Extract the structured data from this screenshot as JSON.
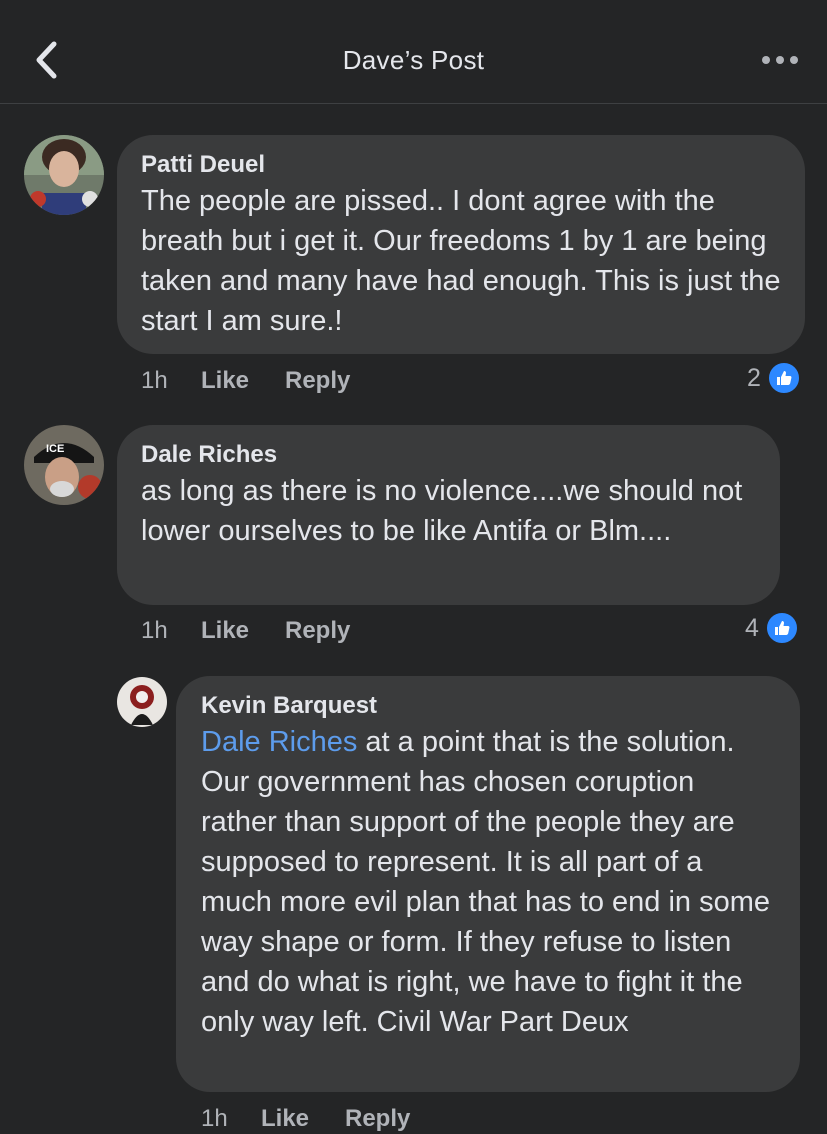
{
  "header": {
    "title": "Dave’s Post"
  },
  "comments": [
    {
      "author": "Patti Deuel",
      "text": "The people are pissed.. I dont agree with the breath but i get it. Our freedoms 1 by 1 are being taken and many have had enough. This is just the start I am sure.!",
      "time": "1h",
      "like_label": "Like",
      "reply_label": "Reply",
      "like_count": "2"
    },
    {
      "author": "Dale Riches",
      "text": "as long as there is no violence....we should not lower ourselves to be like Antifa or Blm....",
      "time": "1h",
      "like_label": "Like",
      "reply_label": "Reply",
      "like_count": "4"
    },
    {
      "author": "Kevin Barquest",
      "mention": "Dale Riches",
      "text": " at a point that is the solution. Our government has chosen coruption rather than support of the people they are supposed to represent. It is all part of a much more evil plan that has to end in some way shape or form. If they refuse to listen and do what is right, we have to fight it the only way left. Civil War Part Deux",
      "time": "1h",
      "like_label": "Like",
      "reply_label": "Reply"
    }
  ],
  "icons": {
    "back": "chevron-left-icon",
    "more": "more-horizontal-icon",
    "like": "thumbs-up-icon"
  },
  "colors": {
    "background": "#242526",
    "bubble": "#3a3b3c",
    "mention": "#5d9cec",
    "like_blue": "#2d88ff"
  }
}
